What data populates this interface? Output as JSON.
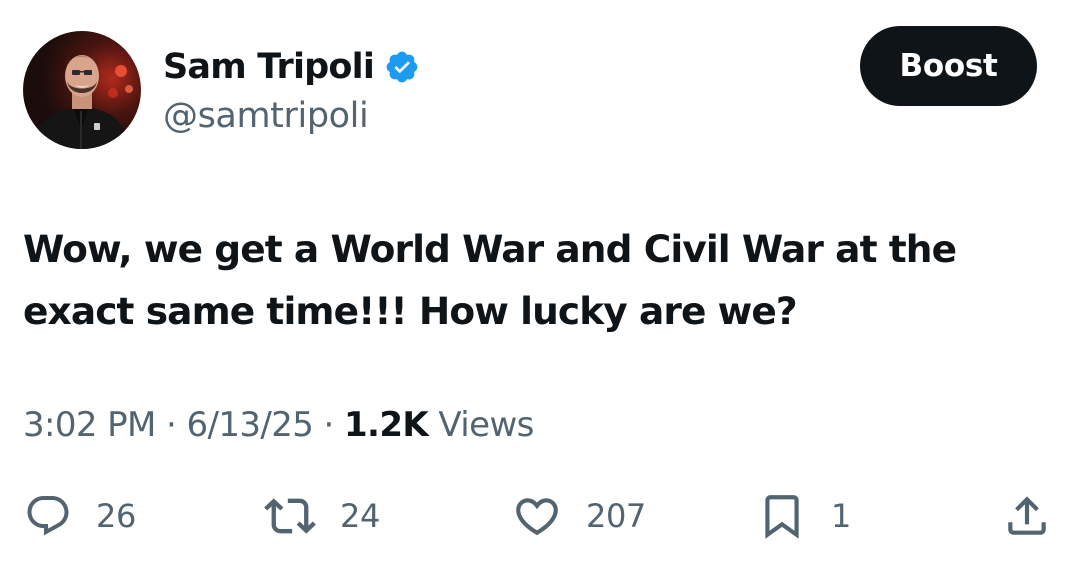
{
  "author": {
    "display_name": "Sam Tripoli",
    "handle": "@samtripoli",
    "verified_icon": "verified-badge-icon",
    "avatar": "profile-photo"
  },
  "header": {
    "boost_label": "Boost"
  },
  "tweet": {
    "text": "Wow, we get a World War and Civil War at the exact same time!!! How lucky are we?",
    "time": "3:02 PM",
    "date": "6/13/25",
    "views_count": "1.2K",
    "views_label": "Views",
    "separator": "·"
  },
  "actions": {
    "replies": {
      "icon": "reply-icon",
      "count": "26"
    },
    "reposts": {
      "icon": "repost-icon",
      "count": "24"
    },
    "likes": {
      "icon": "heart-icon",
      "count": "207"
    },
    "bookmarks": {
      "icon": "bookmark-icon",
      "count": "1"
    },
    "share": {
      "icon": "share-icon"
    }
  },
  "colors": {
    "text_primary": "#0f1419",
    "text_secondary": "#536471",
    "verified_blue": "#1d9bf0",
    "button_bg": "#0f1419"
  }
}
